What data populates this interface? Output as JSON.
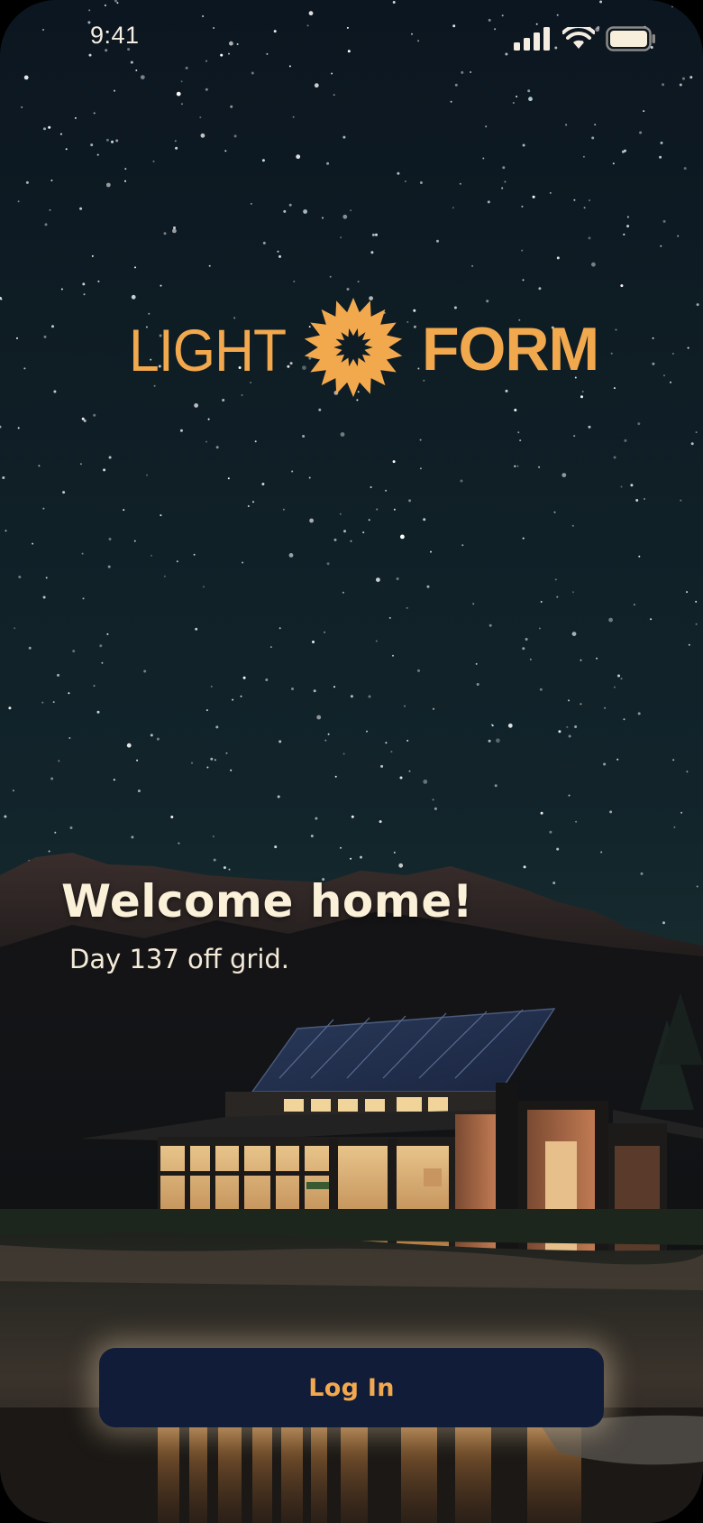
{
  "status_bar": {
    "time": "9:41",
    "icons": [
      "signal-icon",
      "wifi-icon",
      "battery-icon"
    ]
  },
  "logo": {
    "word_left": "LIGHT",
    "word_right": "FORM",
    "emblem": "sun-icon",
    "color": "#f2a94e"
  },
  "hero": {
    "title": "Welcome home!",
    "subtitle": "Day 137 off grid."
  },
  "actions": {
    "login_label": "Log In"
  },
  "colors": {
    "accent": "#f2a94e",
    "button_bg": "#111c38",
    "title_text": "#fbf0d8"
  }
}
